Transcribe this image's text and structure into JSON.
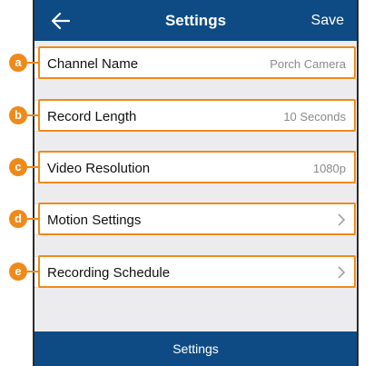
{
  "nav": {
    "title": "Settings",
    "save_label": "Save"
  },
  "rows": [
    {
      "label": "Channel Name",
      "value": "Porch Camera",
      "badge": "a"
    },
    {
      "label": "Record Length",
      "value": "10 Seconds",
      "badge": "b"
    },
    {
      "label": "Video Resolution",
      "value": "1080p",
      "badge": "c"
    },
    {
      "label": "Motion Settings",
      "value": "",
      "badge": "d"
    },
    {
      "label": "Recording Schedule",
      "value": "",
      "badge": "e"
    }
  ],
  "bottom_bar": {
    "label": "Settings"
  },
  "colors": {
    "header": "#0e4b84",
    "highlight": "#ef8a1a",
    "background": "#ececef"
  }
}
